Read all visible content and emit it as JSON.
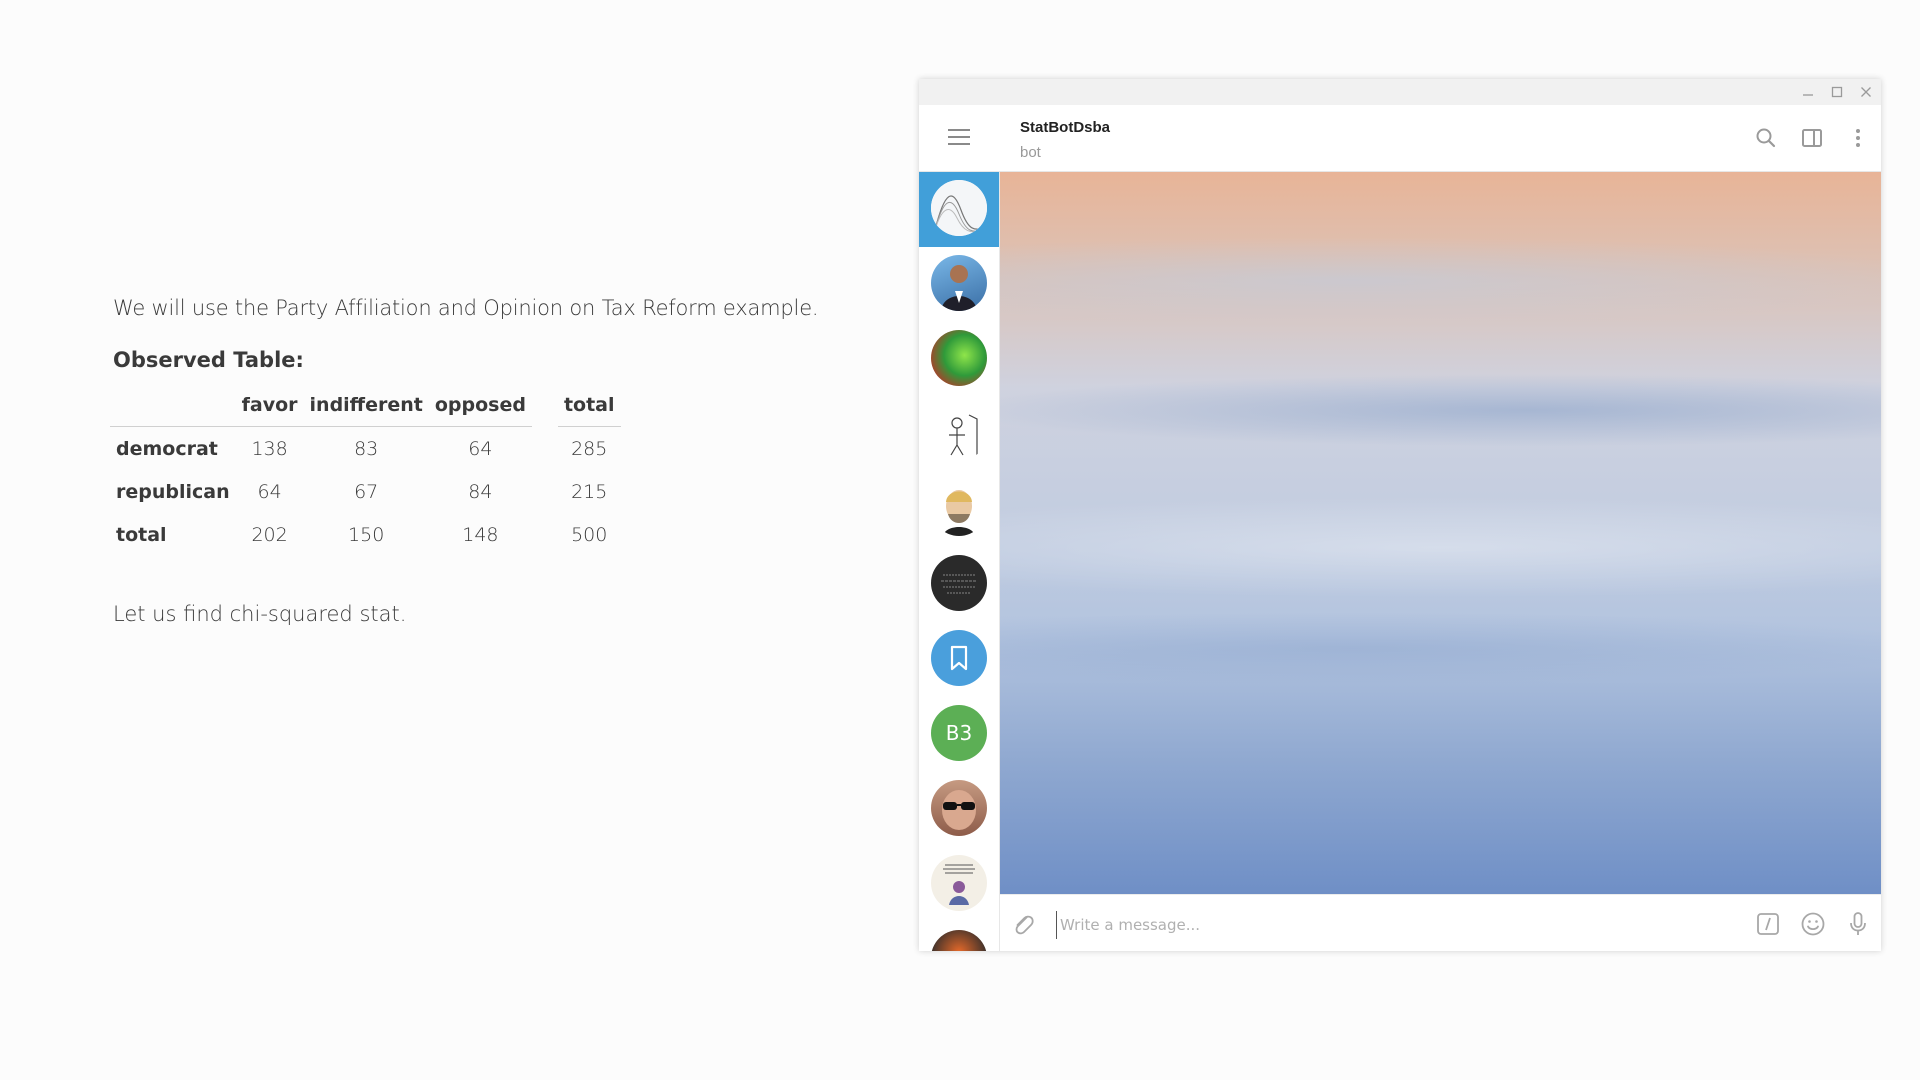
{
  "document": {
    "intro": "We will use the Party Affiliation and Opinion on Tax Reform example.",
    "heading": "Observed Table:",
    "table": {
      "columns": [
        "favor",
        "indifferent",
        "opposed",
        "total"
      ],
      "rows": [
        {
          "label": "democrat",
          "cells": [
            "138",
            "83",
            "64",
            "285"
          ]
        },
        {
          "label": "republican",
          "cells": [
            "64",
            "67",
            "84",
            "215"
          ]
        },
        {
          "label": "total",
          "cells": [
            "202",
            "150",
            "148",
            "500"
          ]
        }
      ]
    },
    "outro": "Let us find chi-squared stat."
  },
  "telegram": {
    "window_controls": [
      "minimize-icon",
      "maximize-icon",
      "close-icon"
    ],
    "chat": {
      "title": "StatBotDsba",
      "status": "bot"
    },
    "header_icons": [
      "search-icon",
      "sidebar-toggle-icon",
      "more-vertical-icon"
    ],
    "sidebar": {
      "menu_icon": "hamburger-menu-icon",
      "chats": [
        {
          "kind": "chart-avatar",
          "active": true
        },
        {
          "kind": "person-avatar"
        },
        {
          "kind": "colorful-avatar"
        },
        {
          "kind": "sketch-avatar"
        },
        {
          "kind": "face-avatar"
        },
        {
          "kind": "dark-text-avatar"
        },
        {
          "kind": "saved-messages",
          "icon": "bookmark-icon"
        },
        {
          "kind": "letters",
          "letters": "B3"
        },
        {
          "kind": "sunglasses-avatar"
        },
        {
          "kind": "poster-avatar"
        },
        {
          "kind": "partial-avatar"
        }
      ]
    },
    "composer": {
      "placeholder": "Write a message...",
      "icons": [
        "attach-icon",
        "bot-command-icon",
        "emoji-icon",
        "microphone-icon"
      ]
    },
    "colors": {
      "accent": "#419fd9",
      "saved_messages": "#4a9fdc",
      "letters_avatar": "#5caf55"
    }
  }
}
